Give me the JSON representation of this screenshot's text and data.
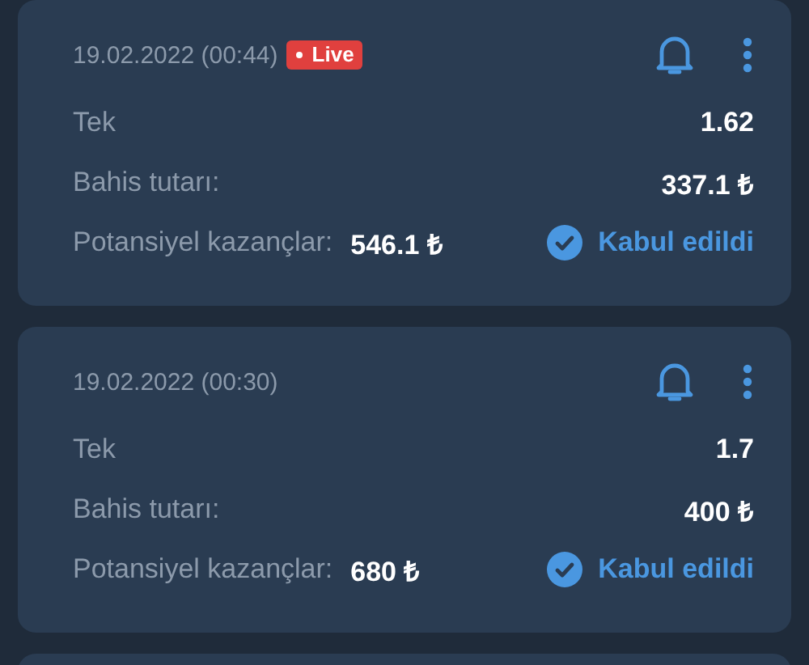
{
  "bets": [
    {
      "date": "19.02.2022 (00:44)",
      "live": true,
      "live_label": "Live",
      "type_label": "Tek",
      "odds": "1.62",
      "stake_label": "Bahis tutarı:",
      "stake": "337.1 ₺",
      "win_label": "Potansiyel kazançlar:",
      "win": "546.1 ₺",
      "status": {
        "kind": "accepted",
        "label": "Kabul edildi"
      }
    },
    {
      "date": "19.02.2022 (00:30)",
      "live": false,
      "type_label": "Tek",
      "odds": "1.7",
      "stake_label": "Bahis tutarı:",
      "stake": "400 ₺",
      "win_label": "Potansiyel kazançlar:",
      "win": "680 ₺",
      "status": {
        "kind": "accepted",
        "label": "Kabul edildi"
      }
    }
  ]
}
